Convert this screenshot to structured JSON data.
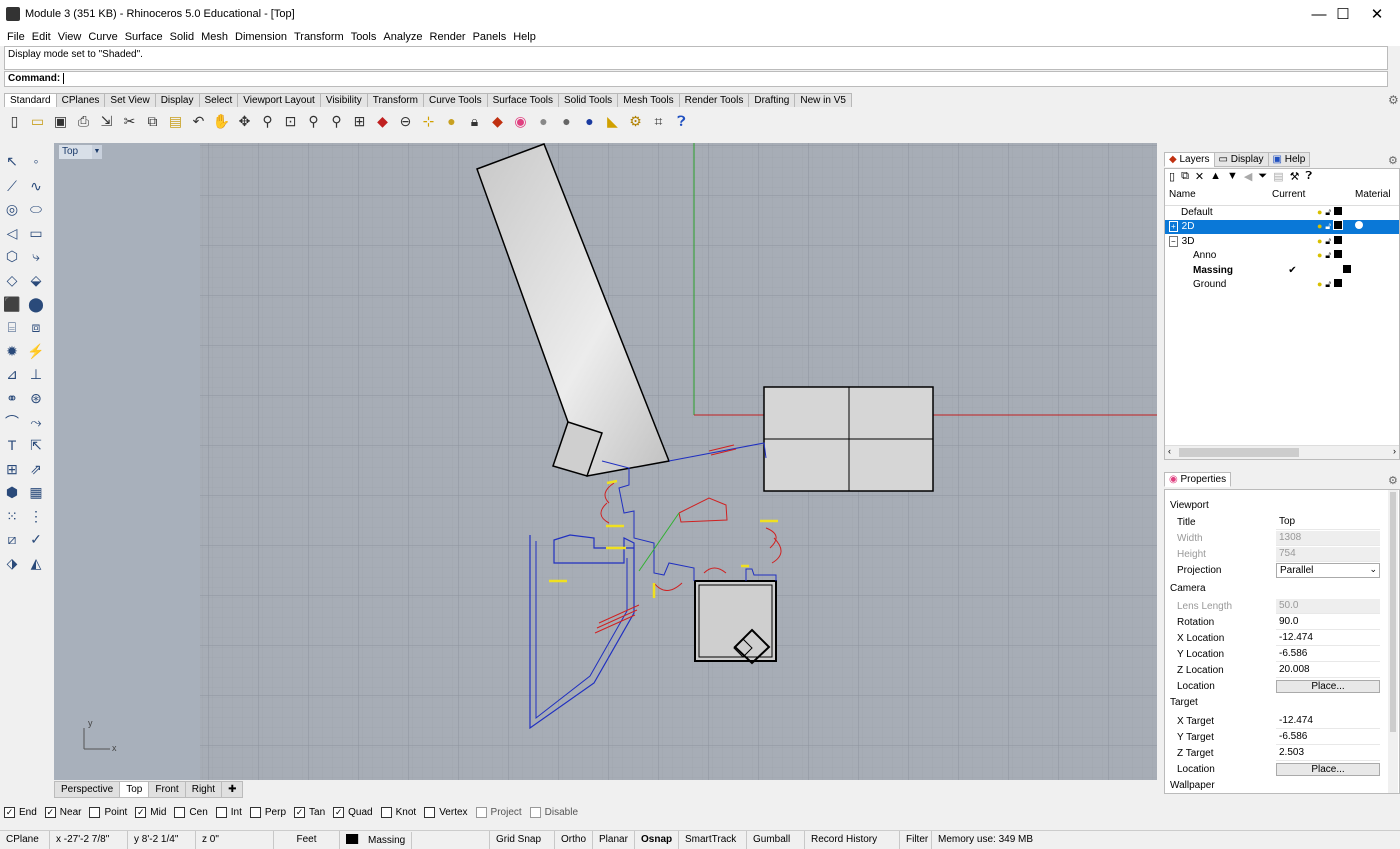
{
  "window": {
    "title": "Module 3 (351 KB) - Rhinoceros 5.0 Educational - [Top]",
    "minimize": "—",
    "maximize": "☐",
    "close": "✕"
  },
  "menu": [
    "File",
    "Edit",
    "View",
    "Curve",
    "Surface",
    "Solid",
    "Mesh",
    "Dimension",
    "Transform",
    "Tools",
    "Analyze",
    "Render",
    "Panels",
    "Help"
  ],
  "command": {
    "history": "Display mode set to \"Shaded\".",
    "label": "Command:"
  },
  "toolbar_tabs": [
    "Standard",
    "CPlanes",
    "Set View",
    "Display",
    "Select",
    "Viewport Layout",
    "Visibility",
    "Transform",
    "Curve Tools",
    "Surface Tools",
    "Solid Tools",
    "Mesh Tools",
    "Render Tools",
    "Drafting",
    "New in V5"
  ],
  "toolbar_icons": [
    "new-file-icon",
    "open-file-icon",
    "save-icon",
    "print-icon",
    "import-icon",
    "cut-icon",
    "copy-icon",
    "paste-icon",
    "undo-icon",
    "pan-icon",
    "rotate-view-icon",
    "zoom-icon",
    "zoom-extents-icon",
    "zoom-window-icon",
    "zoom-selected-icon",
    "viewport-layout-icon",
    "car-icon",
    "cplane-icon",
    "snap-icon",
    "light-icon",
    "lock-icon",
    "layer-icon",
    "color-wheel-icon",
    "shaded-sphere-icon",
    "rendered-sphere-icon",
    "render-icon",
    "lamp-icon",
    "settings-gear-icon",
    "grid-snap-icon",
    "help-icon"
  ],
  "viewport": {
    "label": "Top",
    "tabs": [
      "Perspective",
      "Top",
      "Front",
      "Right"
    ],
    "active_tab": "Top",
    "axis_x": "x",
    "axis_y": "y"
  },
  "osnaps": [
    {
      "label": "End",
      "checked": true
    },
    {
      "label": "Near",
      "checked": true
    },
    {
      "label": "Point",
      "checked": false
    },
    {
      "label": "Mid",
      "checked": true
    },
    {
      "label": "Cen",
      "checked": false
    },
    {
      "label": "Int",
      "checked": false
    },
    {
      "label": "Perp",
      "checked": false
    },
    {
      "label": "Tan",
      "checked": true
    },
    {
      "label": "Quad",
      "checked": true
    },
    {
      "label": "Knot",
      "checked": false
    },
    {
      "label": "Vertex",
      "checked": false
    },
    {
      "label": "Project",
      "checked": false
    },
    {
      "label": "Disable",
      "checked": false
    }
  ],
  "status": {
    "cplane": "CPlane",
    "x": "x -27'-2 7/8\"",
    "y": "y 8'-2 1/4\"",
    "z": "z 0\"",
    "units": "Feet",
    "layer": "Massing",
    "grid_snap": "Grid Snap",
    "ortho": "Ortho",
    "planar": "Planar",
    "osnap": "Osnap",
    "smarttrack": "SmartTrack",
    "gumball": "Gumball",
    "record_history": "Record History",
    "filter": "Filter",
    "memory": "Memory use: 349 MB"
  },
  "layers_panel": {
    "tabs": [
      "Layers",
      "Display",
      "Help"
    ],
    "columns": [
      "Name",
      "Current",
      "Material"
    ],
    "rows": [
      {
        "name": "Default",
        "indent": 0,
        "expander": "",
        "current": "",
        "selected": false,
        "bold": false
      },
      {
        "name": "2D",
        "indent": 0,
        "expander": "+",
        "current": "",
        "selected": true,
        "bold": false
      },
      {
        "name": "3D",
        "indent": 0,
        "expander": "−",
        "current": "",
        "selected": false,
        "bold": false
      },
      {
        "name": "Anno",
        "indent": 1,
        "expander": "",
        "current": "",
        "selected": false,
        "bold": false
      },
      {
        "name": "Massing",
        "indent": 1,
        "expander": "",
        "current": "✔",
        "selected": false,
        "bold": true
      },
      {
        "name": "Ground",
        "indent": 1,
        "expander": "",
        "current": "",
        "selected": false,
        "bold": false
      }
    ]
  },
  "properties_panel": {
    "tab": "Properties",
    "sections": {
      "viewport": "Viewport",
      "camera": "Camera",
      "target": "Target",
      "wallpaper": "Wallpaper"
    },
    "viewport_rows": [
      {
        "key": "Title",
        "value": "Top",
        "disabled": false
      },
      {
        "key": "Width",
        "value": "1308",
        "disabled": true
      },
      {
        "key": "Height",
        "value": "754",
        "disabled": true
      },
      {
        "key": "Projection",
        "value": "Parallel",
        "disabled": false
      }
    ],
    "camera_rows": [
      {
        "key": "Lens Length",
        "value": "50.0",
        "disabled": true
      },
      {
        "key": "Rotation",
        "value": "90.0",
        "disabled": false
      },
      {
        "key": "X Location",
        "value": "-12.474",
        "disabled": false
      },
      {
        "key": "Y Location",
        "value": "-6.586",
        "disabled": false
      },
      {
        "key": "Z Location",
        "value": "20.008",
        "disabled": false
      },
      {
        "key": "Location",
        "value": "Place...",
        "disabled": false
      }
    ],
    "target_rows": [
      {
        "key": "X Target",
        "value": "-12.474",
        "disabled": false
      },
      {
        "key": "Y Target",
        "value": "-6.586",
        "disabled": false
      },
      {
        "key": "Z Target",
        "value": "2.503",
        "disabled": false
      },
      {
        "key": "Location",
        "value": "Place...",
        "disabled": false
      }
    ]
  }
}
